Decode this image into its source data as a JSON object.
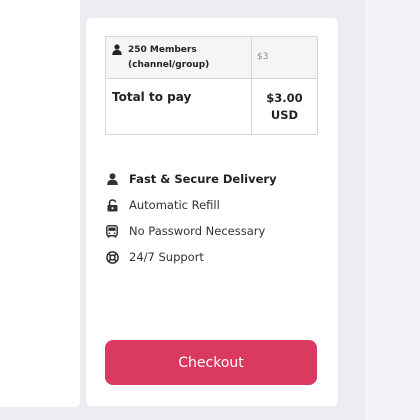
{
  "order": {
    "item_name": "250 Members (channel/group)",
    "item_price": "$3",
    "total_label": "Total to pay",
    "total_amount": "$3.00",
    "total_currency": "USD"
  },
  "features": [
    {
      "label": "Fast & Secure Delivery",
      "icon": "user-icon",
      "bold": true
    },
    {
      "label": "Automatic Refill",
      "icon": "unlock-icon",
      "bold": false
    },
    {
      "label": "No Password Necessary",
      "icon": "bus-icon",
      "bold": false
    },
    {
      "label": "24/7 Support",
      "icon": "lifebuoy-icon",
      "bold": false
    }
  ],
  "checkout": {
    "label": "Checkout"
  },
  "colors": {
    "accent": "#db3a60",
    "background": "#ebedf2",
    "card": "#ffffff",
    "table_border": "#d6d6d6"
  }
}
